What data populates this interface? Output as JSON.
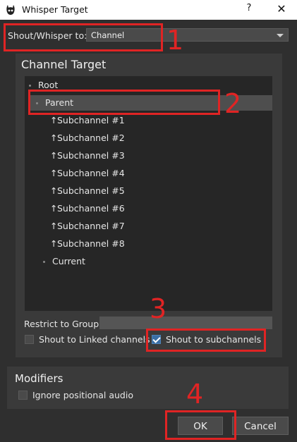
{
  "window": {
    "title": "Whisper Target",
    "help_glyph": "?",
    "close_glyph": "✕"
  },
  "shout": {
    "label": "Shout/Whisper to:",
    "value": "Channel"
  },
  "channel_target": {
    "title": "Channel Target",
    "tree": {
      "root": "Root",
      "parent": "Parent",
      "subchannels": [
        "Subchannel #1",
        "Subchannel #2",
        "Subchannel #3",
        "Subchannel #4",
        "Subchannel #5",
        "Subchannel #6",
        "Subchannel #7",
        "Subchannel #8"
      ],
      "current": "Current",
      "up_arrow_glyph": "↑"
    },
    "restrict_label": "Restrict to Group",
    "restrict_value": "",
    "linked_label": "Shout to Linked channels",
    "linked_checked": false,
    "subchannels_label": "Shout to subchannels",
    "subchannels_checked": true
  },
  "modifiers": {
    "title": "Modifiers",
    "ignore_positional_label": "Ignore positional audio",
    "ignore_positional_checked": false
  },
  "buttons": {
    "ok": "OK",
    "cancel": "Cancel"
  },
  "annotations": {
    "marker_color": "#e02424",
    "labels": [
      "1",
      "2",
      "3",
      "4"
    ]
  }
}
